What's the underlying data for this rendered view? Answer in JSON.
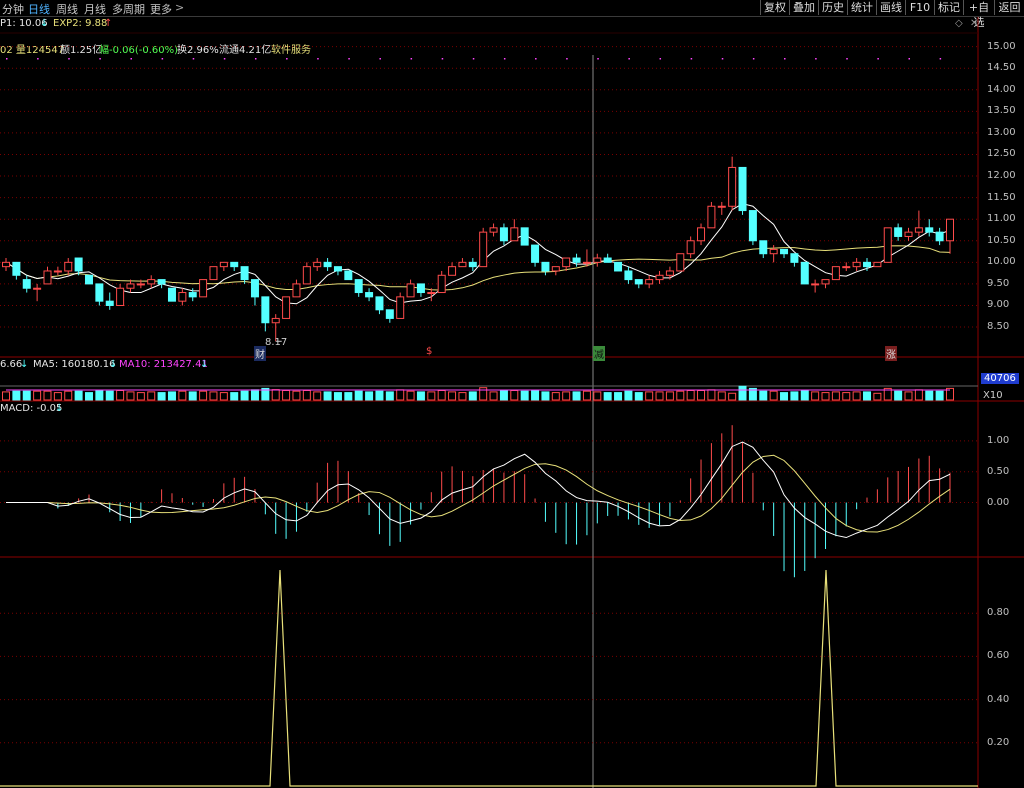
{
  "toolbar": {
    "tabs": [
      "分钟",
      "日线",
      "周线",
      "月线",
      "多周期",
      "更多"
    ],
    "active_tab": "日线",
    "right_buttons": [
      "复权",
      "叠加",
      "历史",
      "统计",
      "画线",
      "F10",
      "标记",
      "+自选",
      "返回"
    ]
  },
  "info": {
    "exp1": "P1: 10.06",
    "exp2": "EXP2: 9.88",
    "line2_a": "02 量124547",
    "line2_b": "额1.25亿",
    "line2_c": "幅-0.06(-0.60%)",
    "line2_d": "换2.96%",
    "line2_e": "流通4.21亿",
    "line2_f": "软件服务"
  },
  "volume_panel": {
    "vol": "6.66",
    "ma5": "MA5: 160180.16",
    "ma10": "MA10: 213427.41",
    "axis_value": "40706",
    "axis_unit": "X10"
  },
  "macd_panel": {
    "label": "MACD: -0.05"
  },
  "markers": {
    "low_label": "8.17",
    "m1": "财",
    "m2": "$",
    "m3": "减",
    "m4": "涨"
  },
  "colors": {
    "up": "#ff4b4b",
    "down": "#54ffff",
    "ma_white": "#ffffff",
    "ma_yellow": "#e8e07a",
    "magenta": "#ff44ff",
    "grid": "#7a0000"
  },
  "chart_data": [
    {
      "type": "candlestick",
      "ylim": [
        8.2,
        15.2
      ],
      "yticks": [
        "15.00",
        "14.50",
        "14.00",
        "13.50",
        "13.00",
        "12.50",
        "12.00",
        "11.50",
        "11.00",
        "10.50",
        "10.00",
        "9.50",
        "9.00",
        "8.50"
      ],
      "candles": [
        [
          9.9,
          10.1,
          9.8,
          10.0
        ],
        [
          10.0,
          10.0,
          9.6,
          9.7
        ],
        [
          9.6,
          9.7,
          9.3,
          9.4
        ],
        [
          9.4,
          9.5,
          9.1,
          9.4
        ],
        [
          9.5,
          9.9,
          9.5,
          9.8
        ],
        [
          9.8,
          9.9,
          9.7,
          9.8
        ],
        [
          9.8,
          10.1,
          9.7,
          10.0
        ],
        [
          10.1,
          10.1,
          9.7,
          9.8
        ],
        [
          9.7,
          9.7,
          9.5,
          9.5
        ],
        [
          9.5,
          9.5,
          9.0,
          9.1
        ],
        [
          9.1,
          9.3,
          8.9,
          9.0
        ],
        [
          9.0,
          9.5,
          9.0,
          9.4
        ],
        [
          9.4,
          9.6,
          9.3,
          9.5
        ],
        [
          9.5,
          9.6,
          9.4,
          9.5
        ],
        [
          9.5,
          9.7,
          9.4,
          9.6
        ],
        [
          9.6,
          9.6,
          9.4,
          9.5
        ],
        [
          9.4,
          9.4,
          9.1,
          9.1
        ],
        [
          9.1,
          9.4,
          9.0,
          9.3
        ],
        [
          9.3,
          9.4,
          9.1,
          9.2
        ],
        [
          9.2,
          9.6,
          9.2,
          9.6
        ],
        [
          9.6,
          9.9,
          9.6,
          9.9
        ],
        [
          9.9,
          10.0,
          9.8,
          10.0
        ],
        [
          10.0,
          10.0,
          9.8,
          9.9
        ],
        [
          9.9,
          9.9,
          9.5,
          9.6
        ],
        [
          9.6,
          9.6,
          9.0,
          9.2
        ],
        [
          9.2,
          9.2,
          8.4,
          8.6
        ],
        [
          8.6,
          8.8,
          8.17,
          8.7
        ],
        [
          8.7,
          9.2,
          8.7,
          9.2
        ],
        [
          9.2,
          9.6,
          9.2,
          9.5
        ],
        [
          9.5,
          10.0,
          9.5,
          9.9
        ],
        [
          9.9,
          10.1,
          9.8,
          10.0
        ],
        [
          10.0,
          10.1,
          9.8,
          9.9
        ],
        [
          9.9,
          9.9,
          9.7,
          9.8
        ],
        [
          9.8,
          9.8,
          9.6,
          9.6
        ],
        [
          9.6,
          9.6,
          9.2,
          9.3
        ],
        [
          9.3,
          9.4,
          9.1,
          9.2
        ],
        [
          9.2,
          9.2,
          8.8,
          8.9
        ],
        [
          8.9,
          8.9,
          8.6,
          8.7
        ],
        [
          8.7,
          9.3,
          8.7,
          9.2
        ],
        [
          9.2,
          9.6,
          9.2,
          9.5
        ],
        [
          9.5,
          9.5,
          9.2,
          9.3
        ],
        [
          9.3,
          9.4,
          9.1,
          9.3
        ],
        [
          9.3,
          9.8,
          9.3,
          9.7
        ],
        [
          9.7,
          10.0,
          9.7,
          9.9
        ],
        [
          9.9,
          10.1,
          9.9,
          10.0
        ],
        [
          10.0,
          10.1,
          9.8,
          9.9
        ],
        [
          9.9,
          10.8,
          9.9,
          10.7
        ],
        [
          10.7,
          10.9,
          10.6,
          10.8
        ],
        [
          10.8,
          10.9,
          10.4,
          10.5
        ],
        [
          10.5,
          11.0,
          10.5,
          10.8
        ],
        [
          10.8,
          10.8,
          10.4,
          10.4
        ],
        [
          10.4,
          10.4,
          9.9,
          10.0
        ],
        [
          10.0,
          10.0,
          9.7,
          9.8
        ],
        [
          9.8,
          9.9,
          9.7,
          9.9
        ],
        [
          9.9,
          10.1,
          9.8,
          10.1
        ],
        [
          10.1,
          10.2,
          9.9,
          10.0
        ],
        [
          10.0,
          10.3,
          9.9,
          10.0
        ],
        [
          10.0,
          10.2,
          9.9,
          10.1
        ],
        [
          10.1,
          10.2,
          10.0,
          10.0
        ],
        [
          10.0,
          10.0,
          9.8,
          9.8
        ],
        [
          9.8,
          9.9,
          9.5,
          9.6
        ],
        [
          9.6,
          9.6,
          9.4,
          9.5
        ],
        [
          9.5,
          9.7,
          9.4,
          9.6
        ],
        [
          9.6,
          9.8,
          9.5,
          9.7
        ],
        [
          9.7,
          9.9,
          9.6,
          9.8
        ],
        [
          9.8,
          10.2,
          9.8,
          10.2
        ],
        [
          10.2,
          10.6,
          10.1,
          10.5
        ],
        [
          10.5,
          10.9,
          10.4,
          10.8
        ],
        [
          10.8,
          11.4,
          10.8,
          11.3
        ],
        [
          11.3,
          11.4,
          11.1,
          11.3
        ],
        [
          11.3,
          12.45,
          11.2,
          12.2
        ],
        [
          12.2,
          12.2,
          11.1,
          11.2
        ],
        [
          11.2,
          11.2,
          10.4,
          10.5
        ],
        [
          10.5,
          10.5,
          10.1,
          10.2
        ],
        [
          10.2,
          10.4,
          10.0,
          10.3
        ],
        [
          10.3,
          10.3,
          10.1,
          10.2
        ],
        [
          10.2,
          10.2,
          9.9,
          10.0
        ],
        [
          10.0,
          10.0,
          9.5,
          9.5
        ],
        [
          9.5,
          9.6,
          9.3,
          9.5
        ],
        [
          9.5,
          9.6,
          9.4,
          9.6
        ],
        [
          9.6,
          9.9,
          9.6,
          9.9
        ],
        [
          9.9,
          10.0,
          9.8,
          9.9
        ],
        [
          9.9,
          10.1,
          9.8,
          10.0
        ],
        [
          10.0,
          10.1,
          9.8,
          9.9
        ],
        [
          9.9,
          10.0,
          9.9,
          10.0
        ],
        [
          10.0,
          10.8,
          10.0,
          10.8
        ],
        [
          10.8,
          10.9,
          10.5,
          10.6
        ],
        [
          10.6,
          10.8,
          10.5,
          10.7
        ],
        [
          10.7,
          11.2,
          10.6,
          10.8
        ],
        [
          10.8,
          11.0,
          10.6,
          10.7
        ],
        [
          10.7,
          10.8,
          10.4,
          10.5
        ],
        [
          10.5,
          11.0,
          10.2,
          11.0
        ]
      ]
    },
    {
      "type": "bar",
      "name": "volume"
    },
    {
      "type": "line",
      "name": "macd",
      "ylim": [
        -0.85,
        1.5
      ],
      "yticks": [
        "1.00",
        "0.50",
        "0.00"
      ]
    },
    {
      "type": "line",
      "name": "signal",
      "ylim": [
        0,
        1
      ],
      "yticks": [
        "0.80",
        "0.60",
        "0.40",
        "0.20"
      ],
      "spikes": [
        0.0,
        0.0,
        1.0,
        0.0,
        0.0,
        1.0,
        0.0
      ]
    }
  ]
}
